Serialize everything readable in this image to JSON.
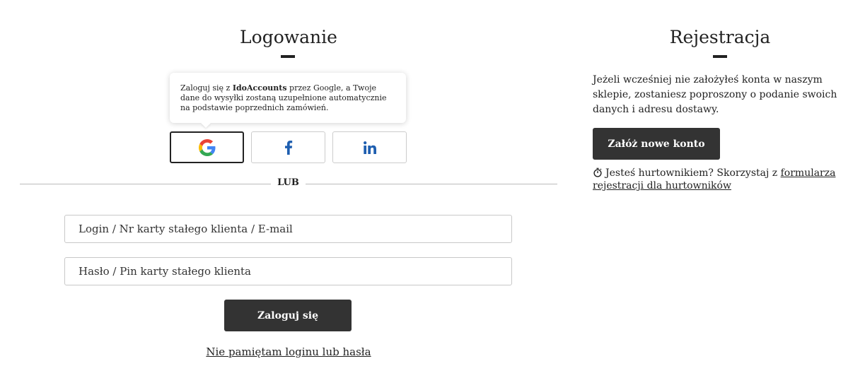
{
  "login": {
    "title": "Logowanie",
    "tooltip": {
      "prefix": "Zaloguj się z ",
      "brand": "IdoAccounts",
      "suffix": " przez Google, a Twoje dane do wysyłki zostaną uzupełnione automatycznie na podstawie poprzednich zamówień."
    },
    "social": [
      {
        "name": "google",
        "icon": "google-icon"
      },
      {
        "name": "facebook",
        "icon": "facebook-icon",
        "color": "#1877f2"
      },
      {
        "name": "linkedin",
        "icon": "linkedin-icon",
        "color": "#0a66c2"
      }
    ],
    "or_label": "LUB",
    "login_placeholder": "Login / Nr karty stałego klienta / E-mail",
    "password_placeholder": "Hasło / Pin karty stałego klienta",
    "submit_label": "Zaloguj się",
    "forgot_label": "Nie pamiętam loginu lub hasła"
  },
  "register": {
    "title": "Rejestracja",
    "description": "Jeżeli wcześniej nie założyłeś konta w naszym sklepie, zostaniesz poproszony o podanie swoich danych i adresu dostawy.",
    "button_label": "Załóż nowe konto",
    "wholesale_text": "Jesteś hurtownikiem? Skorzystaj z ",
    "wholesale_link": "formularza rejestracji dla hurtowników"
  },
  "colors": {
    "dark_button": "#333333",
    "text": "#222222",
    "border": "#cccccc"
  }
}
